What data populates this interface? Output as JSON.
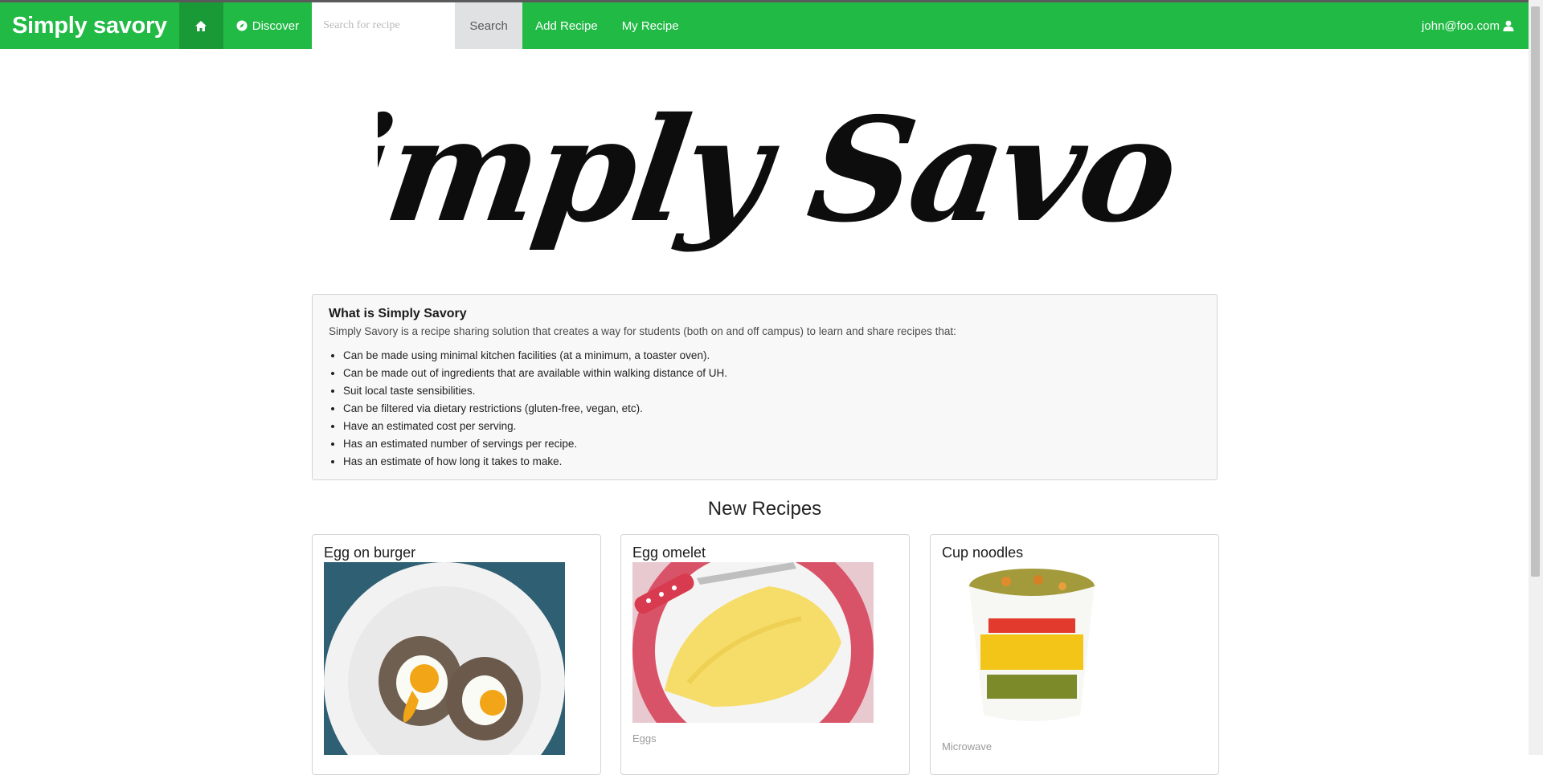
{
  "navbar": {
    "brand": "Simply savory",
    "home_icon": "home-icon",
    "discover_label": "Discover",
    "discover_icon": "compass-icon",
    "search_placeholder": "Search for recipe",
    "search_value": "",
    "search_button": "Search",
    "add_recipe": "Add Recipe",
    "my_recipe": "My Recipe",
    "user_email": "john@foo.com",
    "user_icon": "user-icon",
    "bg_color": "#21ba45"
  },
  "hero": {
    "logo_text": "Simply Savory"
  },
  "about": {
    "heading": "What is Simply Savory",
    "intro": "Simply Savory is a recipe sharing solution that creates a way for students (both on and off campus) to learn and share recipes that:",
    "bullets": [
      "Can be made using minimal kitchen facilities (at a minimum, a toaster oven).",
      "Can be made out of ingredients that are available within walking distance of UH.",
      "Suit local taste sensibilities.",
      "Can be filtered via dietary restrictions (gluten-free, vegan, etc).",
      "Have an estimated cost per serving.",
      "Has an estimated number of servings per recipe.",
      "Has an estimate of how long it takes to make."
    ]
  },
  "new_recipes": {
    "title": "New Recipes",
    "cards": [
      {
        "title": "Egg on burger",
        "meta": ""
      },
      {
        "title": "Egg omelet",
        "meta": "Eggs"
      },
      {
        "title": "Cup noodles",
        "meta": "Microwave"
      }
    ]
  }
}
